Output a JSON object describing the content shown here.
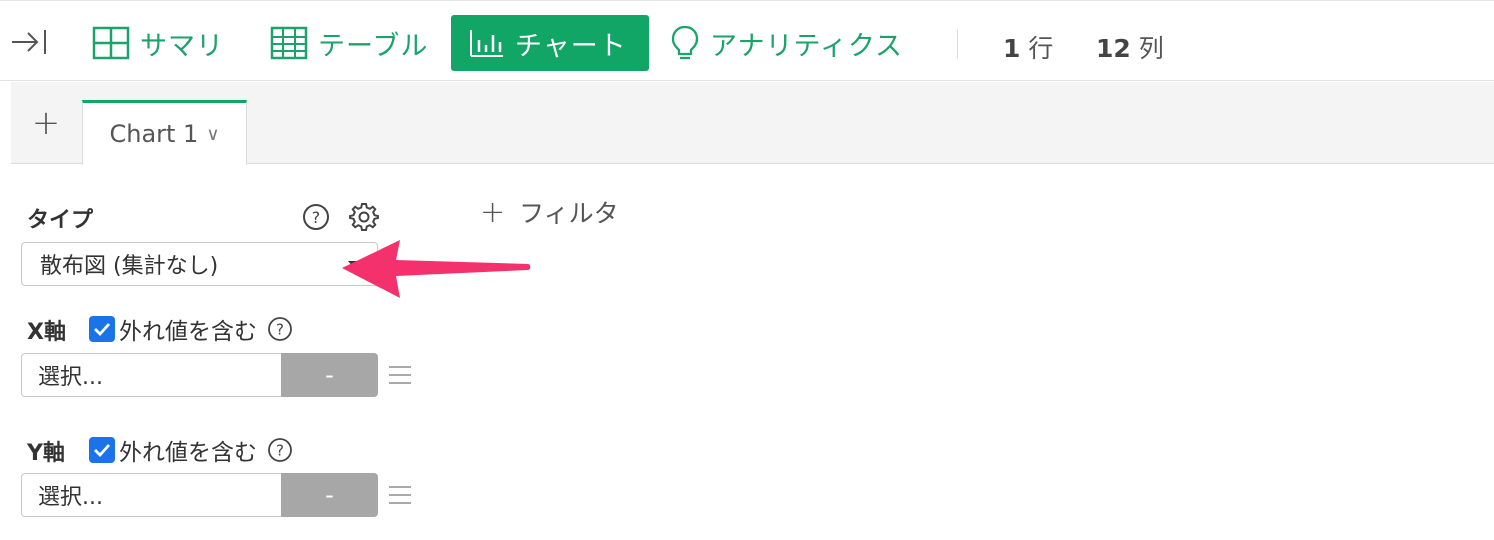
{
  "toolbar": {
    "tabs": [
      {
        "label": "サマリ",
        "icon": "summary-grid-icon"
      },
      {
        "label": "テーブル",
        "icon": "table-icon"
      },
      {
        "label": "チャート",
        "icon": "bar-chart-icon",
        "active": true
      },
      {
        "label": "アナリティクス",
        "icon": "lightbulb-icon"
      }
    ],
    "rows_value": "1",
    "rows_unit": "行",
    "cols_value": "12",
    "cols_unit": "列",
    "accent_color": "#11a566"
  },
  "chart_tabs": {
    "add_label": "+",
    "current": "Chart 1",
    "caret": "∨"
  },
  "panel": {
    "type_label": "タイプ",
    "type_value": "散布図 (集計なし)",
    "filter_label": "フィルタ",
    "x_axis": {
      "label": "X軸",
      "include_outliers": "外れ値を含む",
      "checked": true,
      "field_placeholder": "選択...",
      "agg_button": "-"
    },
    "y_axis": {
      "label": "Y軸",
      "include_outliers": "外れ値を含む",
      "checked": true,
      "field_placeholder": "選択...",
      "agg_button": "-"
    }
  },
  "annotation": {
    "arrow_color": "#f4306d"
  }
}
